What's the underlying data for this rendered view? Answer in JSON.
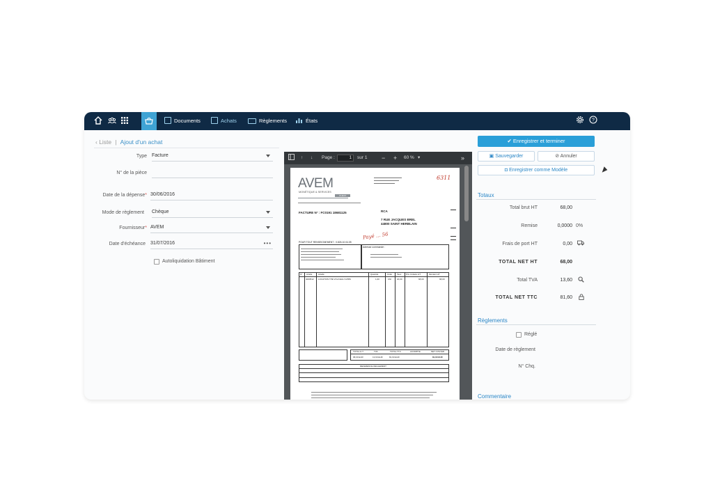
{
  "topbar": {
    "icons": [
      "home-icon",
      "users-icon",
      "grid-icon",
      "basket-icon",
      "gear-icon",
      "help-icon"
    ],
    "nav": [
      {
        "label": "Documents",
        "active": false
      },
      {
        "label": "Achats",
        "active": true
      },
      {
        "label": "Règlements",
        "active": false
      },
      {
        "label": "États",
        "active": false
      }
    ]
  },
  "breadcrumb": {
    "back": "‹ Liste",
    "separator": "|",
    "current": "Ajout d'un achat"
  },
  "form": {
    "type": {
      "label": "Type",
      "value": "Facture"
    },
    "piece": {
      "label": "N° de la pièce",
      "value": ""
    },
    "date_depense": {
      "label": "Date de la dépense",
      "value": "30/06/2016"
    },
    "mode_reglement": {
      "label": "Mode de règlement",
      "value": "Chèque"
    },
    "fournisseur": {
      "label": "Fournisseur",
      "value": "AVEM"
    },
    "date_echeance": {
      "label": "Date d'échéance",
      "value": "31/07/2016"
    },
    "autoliquidation": {
      "label": "Autoliquidation Bâtiment",
      "checked": false
    }
  },
  "viewer": {
    "page_label": "Page :",
    "page_value": "1",
    "page_total": "sur 1",
    "zoom": "60 %",
    "invoice": {
      "logo": "AVEM",
      "logo_sub": "MONÉTIQUE & SERVICES",
      "logo_sub2": "OUEST",
      "facture_no": "FACTURE N° : FC0191 18681125",
      "client": "RCA",
      "address1": "7 RUE JACQUES BREL",
      "address2": "44800 SAINT HERBLAIN",
      "handwrite_top": "6311",
      "handwrite_mid": "Payé ... 56",
      "renseignement": "POUR TOUT RENSEIGNEMENT : 0.826.10.04.05",
      "adresse_commande": "Adresse commande :",
      "col_headers": [
        "N°",
        "Article",
        "Libellé",
        "Quantité",
        "Unité",
        "Taux",
        "Prix Unitaire HT",
        "Montant HT"
      ],
      "row1": [
        "4000512",
        "LOCATION TPE VOL/GELU GPRS",
        "1,00",
        "UNI",
        "20,00",
        "68,00",
        "68,00"
      ],
      "total_headers": [
        "TOTAL H.T.",
        "TVA",
        "TOTAL TTC",
        "ACOMPTE",
        "NET A PAYER"
      ],
      "total_values": [
        "68,00 EUR",
        "13,60 EUR",
        "81,60 EUR",
        "",
        "81,60 EUR"
      ],
      "reglement_title": "REFERENCE REGLEMENT"
    }
  },
  "actions": {
    "save_finish": "Enregistrer et terminer",
    "save": "Sauvegarder",
    "cancel": "Annuler",
    "save_model": "Enregistrer comme Modèle"
  },
  "totaux": {
    "title": "Totaux",
    "total_brut_label": "Total brut HT",
    "total_brut_value": "68,00",
    "remise_label": "Remise",
    "remise_value": "0,0000",
    "remise_pct": "0%",
    "frais_label": "Frais de port HT",
    "frais_value": "0,00",
    "total_net_label": "TOTAL NET HT",
    "total_net_value": "68,00",
    "tva_label": "Total TVA",
    "tva_value": "13,60",
    "ttc_label": "TOTAL NET TTC",
    "ttc_value": "81,60"
  },
  "reglements": {
    "title": "Règlements",
    "regle_label": "Réglé",
    "regle_checked": false,
    "date_label": "Date de règlement",
    "chq_label": "N° Chq."
  },
  "commentaire": {
    "title": "Commentaire"
  },
  "colors": {
    "topbar": "#0f2a45",
    "accent": "#2a9fd8",
    "active_tab": "#3fa3d4"
  }
}
